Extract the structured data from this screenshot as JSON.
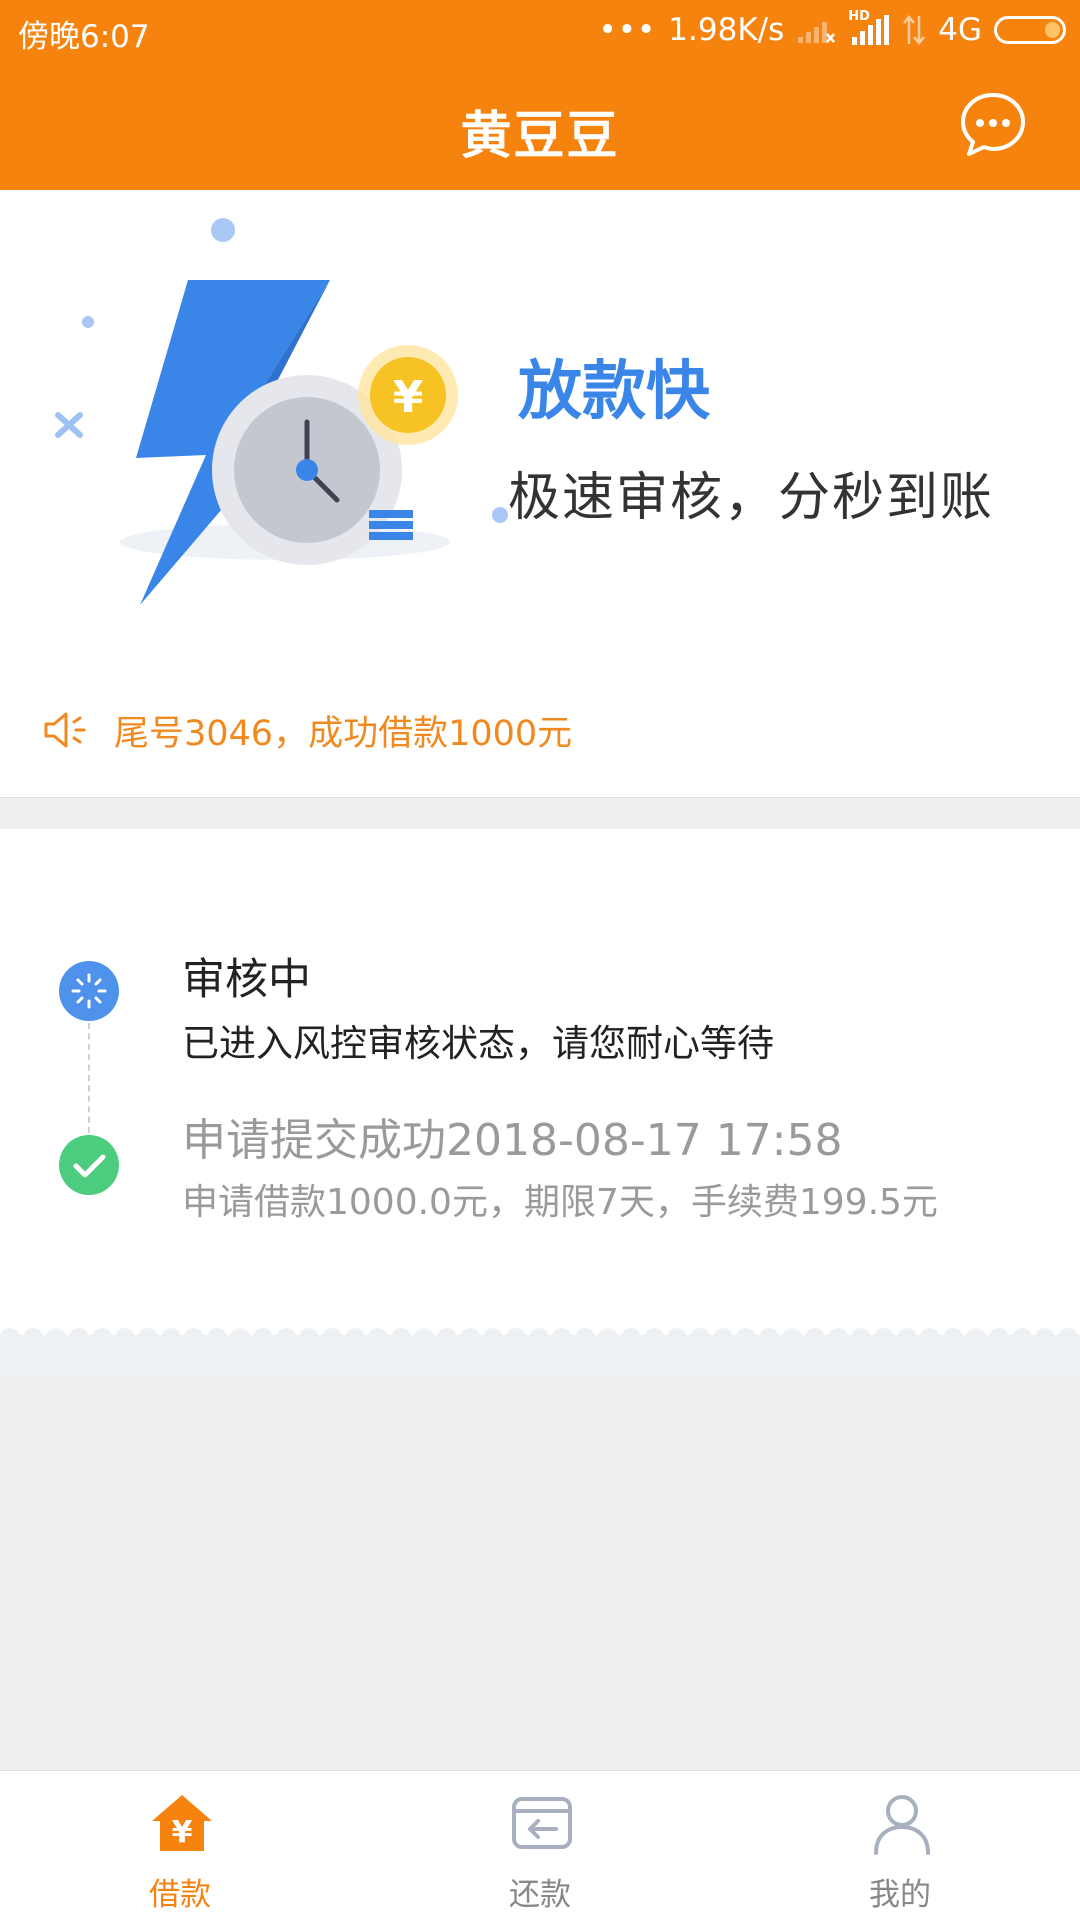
{
  "status_bar": {
    "time": "傍晚6:07",
    "speed": "1.98K/s",
    "hd": "HD",
    "network": "4G"
  },
  "header": {
    "title": "黄豆豆",
    "chat_icon": "chat-bubble-icon"
  },
  "banner": {
    "headline": "放款快",
    "subline": "极速审核，分秒到账",
    "coin_symbol": "¥",
    "illustration": "lightning-clock-illustration"
  },
  "notice": {
    "icon": "speaker-icon",
    "text": "尾号3046，成功借款1000元"
  },
  "steps": [
    {
      "icon": "loading-icon",
      "title": "审核中",
      "description": "已进入风控审核状态，请您耐心等待"
    },
    {
      "icon": "check-icon",
      "title": "申请提交成功2018-08-17 17:58",
      "description": "申请借款1000.0元，期限7天，手续费199.5元"
    }
  ],
  "tabbar": {
    "items": [
      {
        "label": "借款",
        "icon": "loan-house-icon",
        "active": true
      },
      {
        "label": "还款",
        "icon": "repay-card-icon",
        "active": false
      },
      {
        "label": "我的",
        "icon": "user-icon",
        "active": false
      }
    ]
  },
  "colors": {
    "brand_orange": "#f7830f",
    "accent_blue": "#3a86e8",
    "success_green": "#4ccc7e",
    "notice_orange": "#f08a20"
  }
}
